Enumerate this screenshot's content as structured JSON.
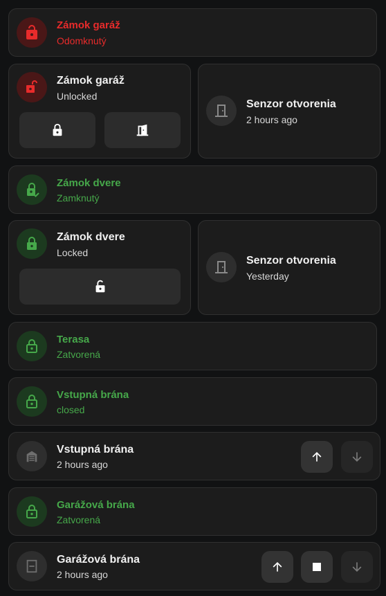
{
  "colors": {
    "red": "#e82b2b",
    "green": "#46a84a",
    "card_bg": "#1c1c1c",
    "page_bg": "#111213"
  },
  "cards": {
    "lock_garage_tile": {
      "name": "Zámok garáž",
      "state": "Odomknutý",
      "icon": "lock-open-icon",
      "color": "red"
    },
    "lock_garage": {
      "name": "Zámok garáž",
      "state": "Unlocked",
      "icon": "lock-open-icon",
      "lock_button_icon": "lock-icon",
      "open_button_icon": "door-open-icon"
    },
    "sensor_1": {
      "name": "Senzor otvorenia",
      "state": "2 hours ago",
      "icon": "door-closed-icon"
    },
    "lock_door_tile": {
      "name": "Zámok dvere",
      "state": "Zamknutý",
      "icon": "lock-check-icon",
      "color": "green"
    },
    "lock_door": {
      "name": "Zámok dvere",
      "state": "Locked",
      "icon": "lock-icon",
      "unlock_button_icon": "lock-open-icon"
    },
    "sensor_2": {
      "name": "Senzor otvorenia",
      "state": "Yesterday",
      "icon": "door-closed-icon"
    },
    "terasa": {
      "name": "Terasa",
      "state": "Zatvorená",
      "icon": "lock-icon",
      "color": "green"
    },
    "gate_tile": {
      "name": "Vstupná brána",
      "state": "closed",
      "icon": "lock-icon",
      "color": "green"
    },
    "gate": {
      "name": "Vstupná brána",
      "state": "2 hours ago",
      "icon": "gate-icon",
      "up_icon": "arrow-up-icon",
      "down_icon": "arrow-down-icon"
    },
    "garage_door_tile": {
      "name": "Garážová brána",
      "state": "Zatvorená",
      "icon": "lock-icon",
      "color": "green"
    },
    "garage_door": {
      "name": "Garážová brána",
      "state": "2 hours ago",
      "icon": "garage-door-icon",
      "up_icon": "arrow-up-icon",
      "stop_icon": "stop-icon",
      "down_icon": "arrow-down-icon"
    }
  }
}
